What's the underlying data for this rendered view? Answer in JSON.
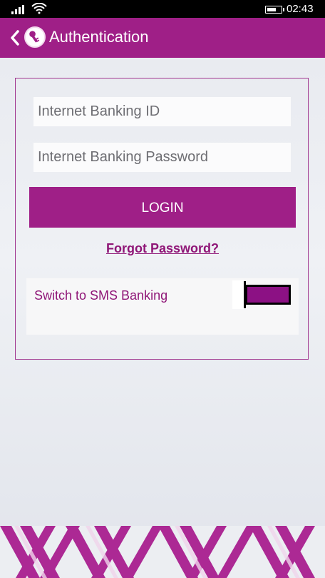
{
  "status_bar": {
    "time": "02:43",
    "icons": [
      "signal-bars-icon",
      "wifi-icon",
      "battery-icon"
    ]
  },
  "header": {
    "title": "Authentication",
    "back_icon": "chevron-left-icon",
    "badge_icon": "key-icon",
    "color": "#9f1f87"
  },
  "form": {
    "id_placeholder": "Internet Banking ID",
    "password_placeholder": "Internet Banking Password",
    "login_label": "LOGIN",
    "forgot_password_label": "Forgot Password?",
    "sms_label": "Switch to SMS Banking",
    "sms_toggle_on": true,
    "accent": "#8f1677"
  }
}
